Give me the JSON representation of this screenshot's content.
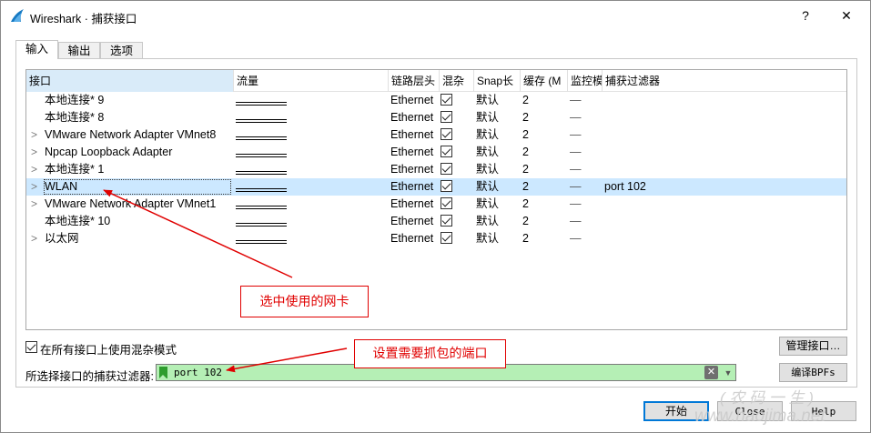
{
  "window": {
    "title": "Wireshark · 捕获接口",
    "help_glyph": "?",
    "close_glyph": "✕",
    "accent_color": "#0078d7"
  },
  "tabs": [
    {
      "label": "输入",
      "active": true
    },
    {
      "label": "输出",
      "active": false
    },
    {
      "label": "选项",
      "active": false
    }
  ],
  "table": {
    "columns": [
      "接口",
      "流量",
      "链路层头",
      "混杂",
      "Snap长",
      "缓存 (M",
      "监控模",
      "捕获过滤器"
    ],
    "rows": [
      {
        "expander": "",
        "name": "本地连接* 9",
        "link": "Ethernet",
        "promisc": true,
        "snap": "默认",
        "buffer": "2",
        "monitor": "—",
        "filter": "",
        "selected": false
      },
      {
        "expander": "",
        "name": "本地连接* 8",
        "link": "Ethernet",
        "promisc": true,
        "snap": "默认",
        "buffer": "2",
        "monitor": "—",
        "filter": "",
        "selected": false
      },
      {
        "expander": ">",
        "name": "VMware Network Adapter VMnet8",
        "link": "Ethernet",
        "promisc": true,
        "snap": "默认",
        "buffer": "2",
        "monitor": "—",
        "filter": "",
        "selected": false
      },
      {
        "expander": ">",
        "name": "Npcap Loopback Adapter",
        "link": "Ethernet",
        "promisc": true,
        "snap": "默认",
        "buffer": "2",
        "monitor": "—",
        "filter": "",
        "selected": false
      },
      {
        "expander": ">",
        "name": "本地连接* 1",
        "link": "Ethernet",
        "promisc": true,
        "snap": "默认",
        "buffer": "2",
        "monitor": "—",
        "filter": "",
        "selected": false
      },
      {
        "expander": ">",
        "name": "WLAN",
        "link": "Ethernet",
        "promisc": true,
        "snap": "默认",
        "buffer": "2",
        "monitor": "—",
        "filter": "port 102",
        "selected": true
      },
      {
        "expander": ">",
        "name": "VMware Network Adapter VMnet1",
        "link": "Ethernet",
        "promisc": true,
        "snap": "默认",
        "buffer": "2",
        "monitor": "—",
        "filter": "",
        "selected": false
      },
      {
        "expander": "",
        "name": "本地连接* 10",
        "link": "Ethernet",
        "promisc": true,
        "snap": "默认",
        "buffer": "2",
        "monitor": "—",
        "filter": "",
        "selected": false
      },
      {
        "expander": ">",
        "name": "以太网",
        "link": "Ethernet",
        "promisc": true,
        "snap": "默认",
        "buffer": "2",
        "monitor": "—",
        "filter": "",
        "selected": false
      }
    ]
  },
  "options": {
    "promisc_all_label": "在所有接口上使用混杂模式",
    "promisc_all_checked": true,
    "filter_label": "所选择接口的捕获过滤器:",
    "filter_value": "port 102",
    "filter_valid_color": "#b5efb5",
    "manage_button": "管理接口…",
    "compile_button": "编译BPFs"
  },
  "buttons": {
    "start": "开始",
    "close": "Close",
    "help": "Help"
  },
  "annotations": {
    "select_nic": "选中使用的网卡",
    "set_port": "设置需要抓包的端口",
    "color": "#e00000"
  },
  "watermark": {
    "line1": "( 农 码 一 生 )",
    "line2": "www.haojima.net"
  }
}
